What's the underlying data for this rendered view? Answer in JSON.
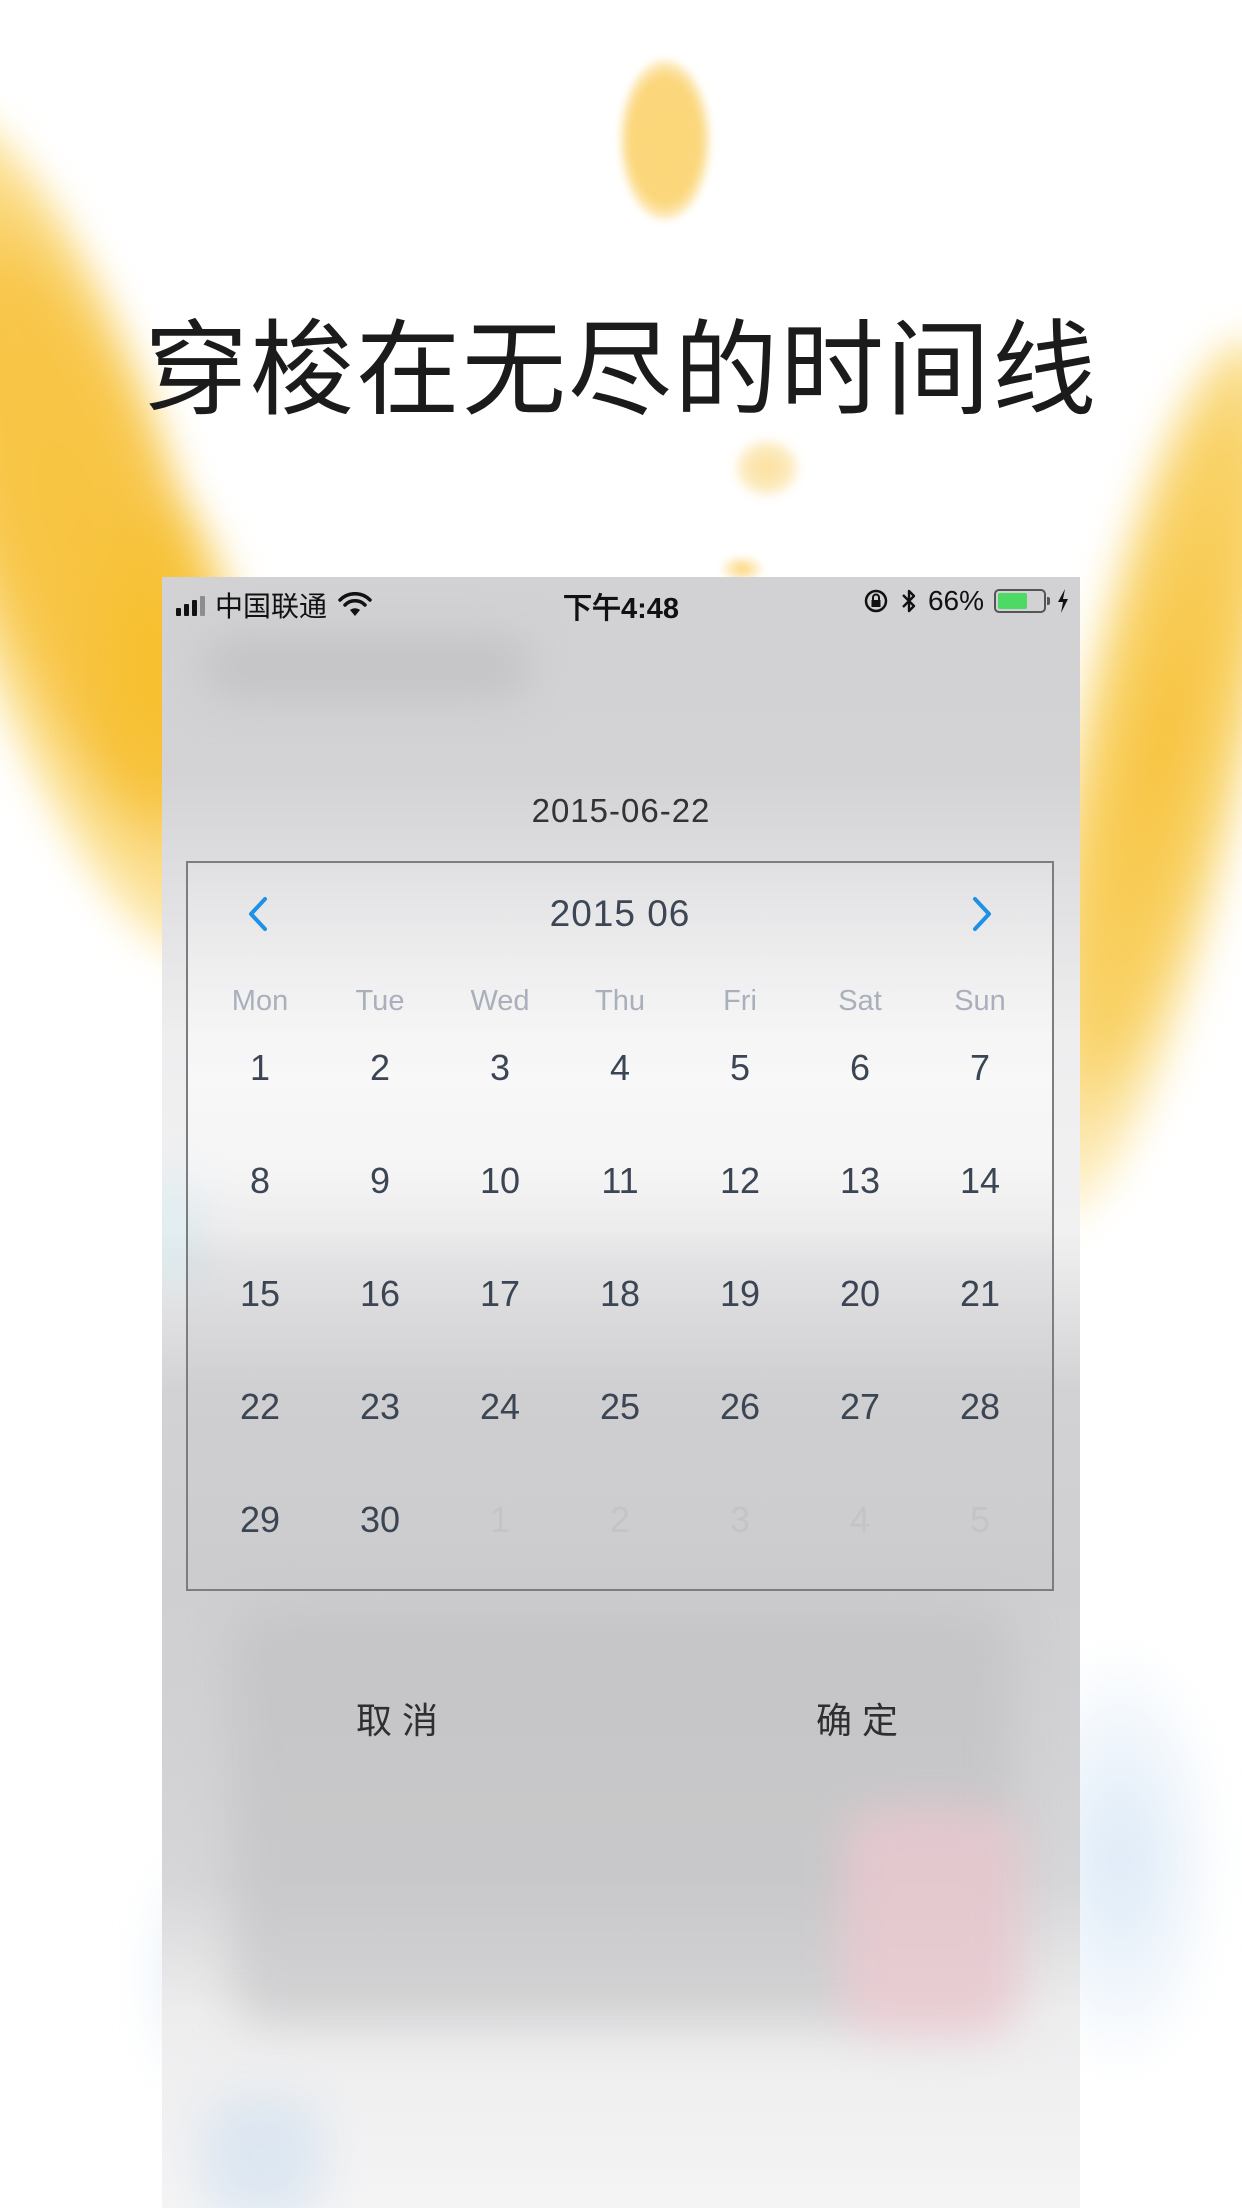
{
  "headline": "穿梭在无尽的时间线",
  "status_bar": {
    "carrier": "中国联通",
    "time": "下午4:48",
    "battery_percent": "66%",
    "battery_level": 0.66,
    "battery_color": "#4cd964",
    "icons": [
      "signal-icon",
      "wifi-icon",
      "orientation-lock-icon",
      "bluetooth-icon",
      "battery-icon",
      "charging-icon"
    ]
  },
  "selected_date": "2015-06-22",
  "calendar": {
    "month_label": "2015 06",
    "nav_color": "#1e90e6",
    "weekdays": [
      "Mon",
      "Tue",
      "Wed",
      "Thu",
      "Fri",
      "Sat",
      "Sun"
    ],
    "days": [
      {
        "label": "1",
        "muted": false
      },
      {
        "label": "2",
        "muted": false
      },
      {
        "label": "3",
        "muted": false
      },
      {
        "label": "4",
        "muted": false
      },
      {
        "label": "5",
        "muted": false
      },
      {
        "label": "6",
        "muted": false
      },
      {
        "label": "7",
        "muted": false
      },
      {
        "label": "8",
        "muted": false
      },
      {
        "label": "9",
        "muted": false
      },
      {
        "label": "10",
        "muted": false
      },
      {
        "label": "11",
        "muted": false
      },
      {
        "label": "12",
        "muted": false
      },
      {
        "label": "13",
        "muted": false
      },
      {
        "label": "14",
        "muted": false
      },
      {
        "label": "15",
        "muted": false
      },
      {
        "label": "16",
        "muted": false
      },
      {
        "label": "17",
        "muted": false
      },
      {
        "label": "18",
        "muted": false
      },
      {
        "label": "19",
        "muted": false
      },
      {
        "label": "20",
        "muted": false
      },
      {
        "label": "21",
        "muted": false
      },
      {
        "label": "22",
        "muted": false
      },
      {
        "label": "23",
        "muted": false
      },
      {
        "label": "24",
        "muted": false
      },
      {
        "label": "25",
        "muted": false
      },
      {
        "label": "26",
        "muted": false
      },
      {
        "label": "27",
        "muted": false
      },
      {
        "label": "28",
        "muted": false
      },
      {
        "label": "29",
        "muted": false
      },
      {
        "label": "30",
        "muted": false
      },
      {
        "label": "1",
        "muted": true
      },
      {
        "label": "2",
        "muted": true
      },
      {
        "label": "3",
        "muted": true
      },
      {
        "label": "4",
        "muted": true
      },
      {
        "label": "5",
        "muted": true
      }
    ]
  },
  "actions": {
    "cancel_label": "取消",
    "confirm_label": "确定"
  }
}
